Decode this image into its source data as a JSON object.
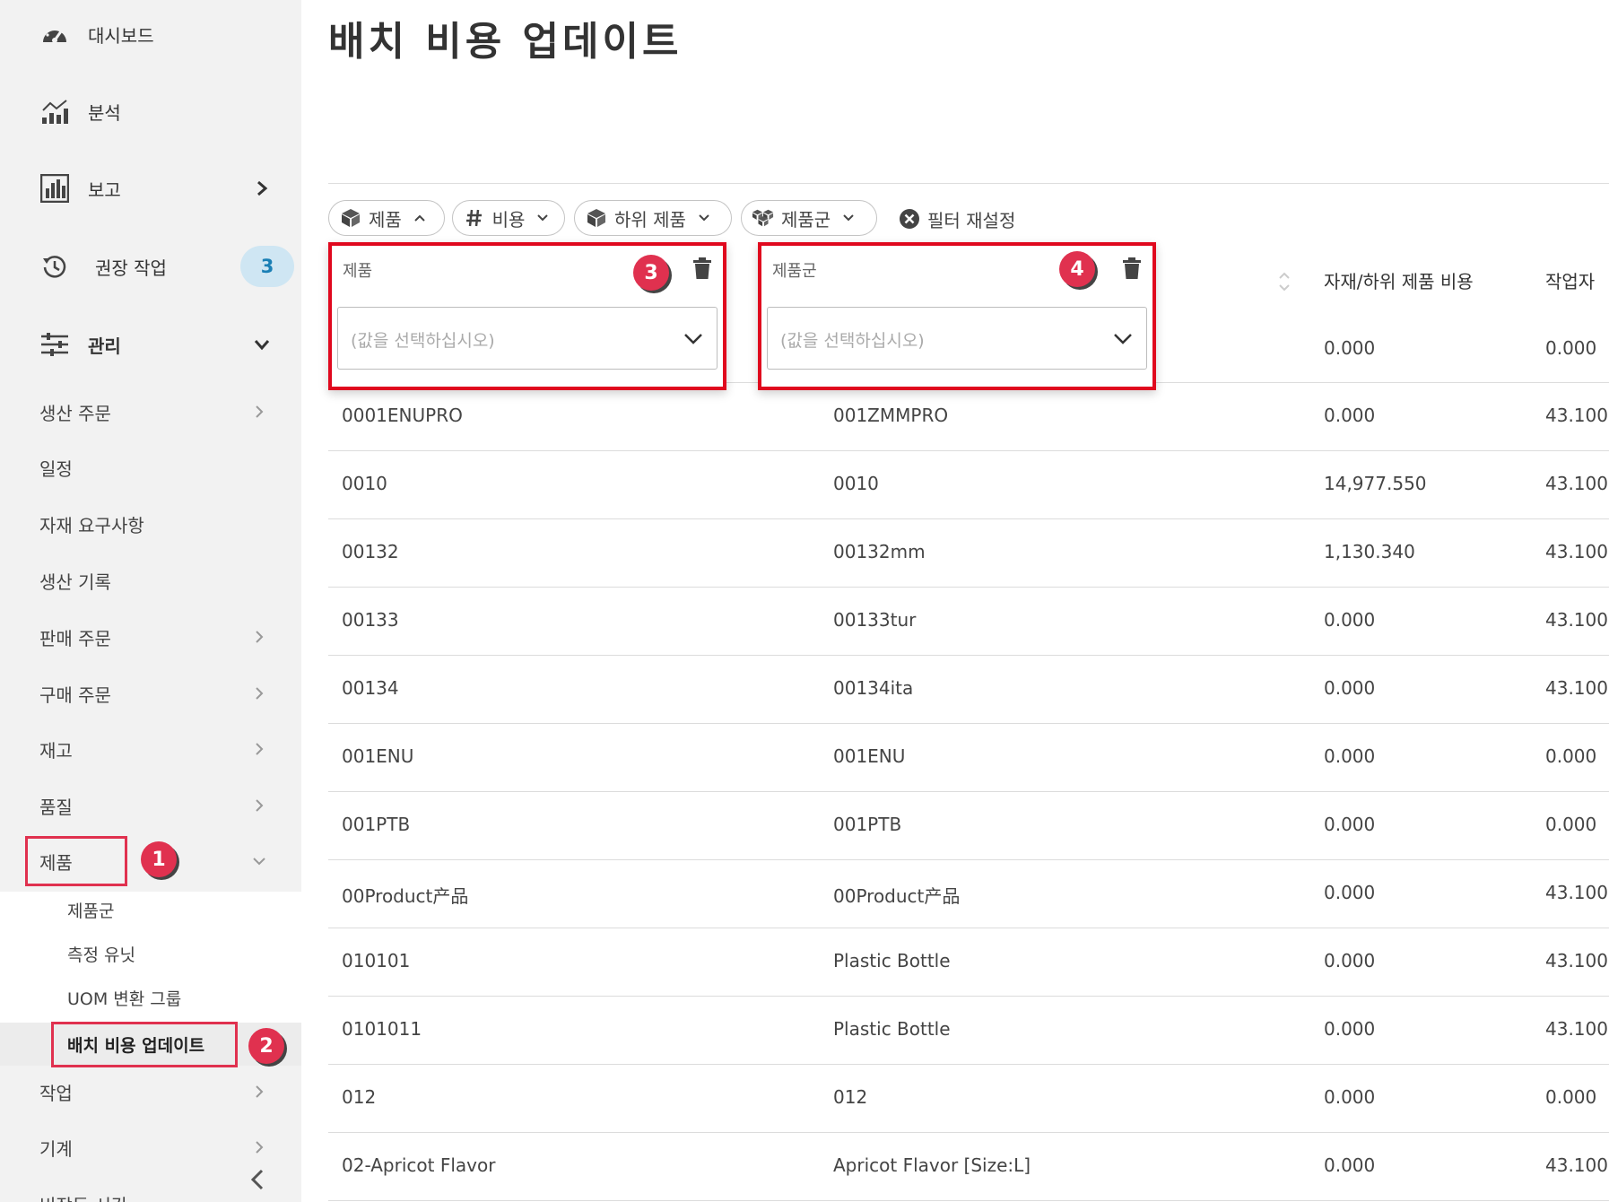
{
  "sidebar": {
    "dashboard": "대시보드",
    "analysis": "분석",
    "report": "보고",
    "recommended": "권장 작업",
    "recommended_count": "3",
    "management": "관리",
    "items": [
      "생산 주문",
      "일정",
      "자재 요구사항",
      "생산 기록",
      "판매 주문",
      "구매 주문",
      "재고",
      "품질",
      "제품"
    ],
    "sub_items": [
      "제품군",
      "측정 유닛",
      "UOM 변환 그룹",
      "배치 비용 업데이트"
    ],
    "after_items": [
      "작업",
      "기계",
      "비작동 시간"
    ]
  },
  "markers": [
    "1",
    "2",
    "3",
    "4"
  ],
  "page": {
    "title": "배치 비용 업데이트"
  },
  "filters": {
    "chips": [
      "제품",
      "비용",
      "하위 제품",
      "제품군"
    ],
    "reset_label": "필터 재설정",
    "panel_product": {
      "title": "제품",
      "placeholder": "(값을 선택하십시오)"
    },
    "panel_group": {
      "title": "제품군",
      "placeholder": "(값을 선택하십시오)"
    }
  },
  "table": {
    "headers": [
      "자재/하위 제품 비용",
      "작업자"
    ],
    "rows": [
      [
        "",
        "",
        "0.000",
        "0.000"
      ],
      [
        "0001ENUPRO",
        "001ZMMPRO",
        "0.000",
        "43.100"
      ],
      [
        "0010",
        "0010",
        "14,977.550",
        "43.100"
      ],
      [
        "00132",
        "00132mm",
        "1,130.340",
        "43.100"
      ],
      [
        "00133",
        "00133tur",
        "0.000",
        "43.100"
      ],
      [
        "00134",
        "00134ita",
        "0.000",
        "43.100"
      ],
      [
        "001ENU",
        "001ENU",
        "0.000",
        "0.000"
      ],
      [
        "001PTB",
        "001PTB",
        "0.000",
        "0.000"
      ],
      [
        "00Product产品",
        "00Product产品",
        "0.000",
        "43.100"
      ],
      [
        "010101",
        "Plastic Bottle",
        "0.000",
        "43.100"
      ],
      [
        "0101011",
        "Plastic Bottle",
        "0.000",
        "43.100"
      ],
      [
        "012",
        "012",
        "0.000",
        "0.000"
      ],
      [
        "02-Apricot Flavor",
        "Apricot Flavor [Size:L]",
        "0.000",
        "43.100"
      ]
    ]
  },
  "colors": {
    "highlight": "#e0314f",
    "badge_bg": "#cfe6f3",
    "badge_text": "#1a7fb5",
    "sidebar_bg": "#f2f2f2"
  }
}
